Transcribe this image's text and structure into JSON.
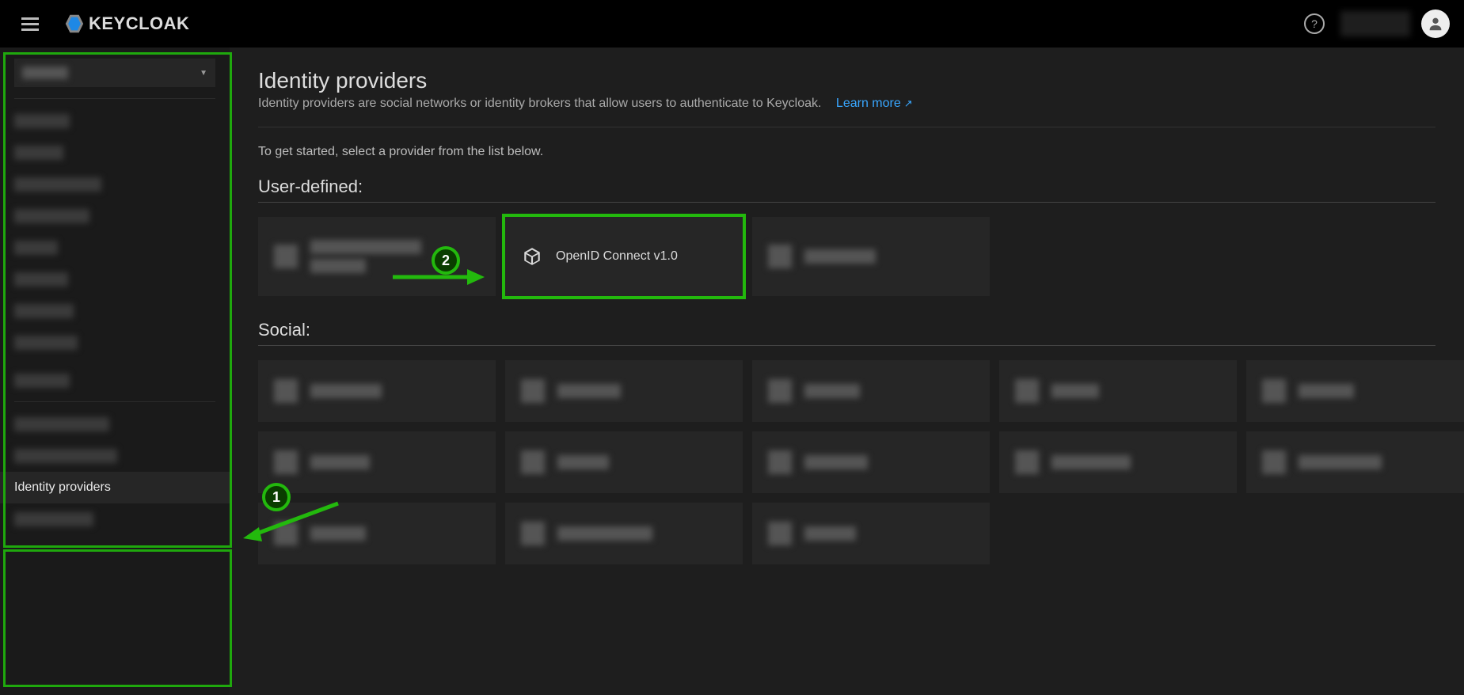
{
  "brand": {
    "name": "KEYCLOAK"
  },
  "sidebar": {
    "active_label": "Identity providers"
  },
  "page": {
    "title": "Identity providers",
    "description": "Identity providers are social networks or identity brokers that allow users to authenticate to Keycloak.",
    "learn_more": "Learn more",
    "starter": "To get started, select a provider from the list below."
  },
  "sections": {
    "user_defined": {
      "label": "User-defined:",
      "openid_label": "OpenID Connect v1.0"
    },
    "social": {
      "label": "Social:"
    }
  },
  "annotations": {
    "step1": "1",
    "step2": "2"
  }
}
